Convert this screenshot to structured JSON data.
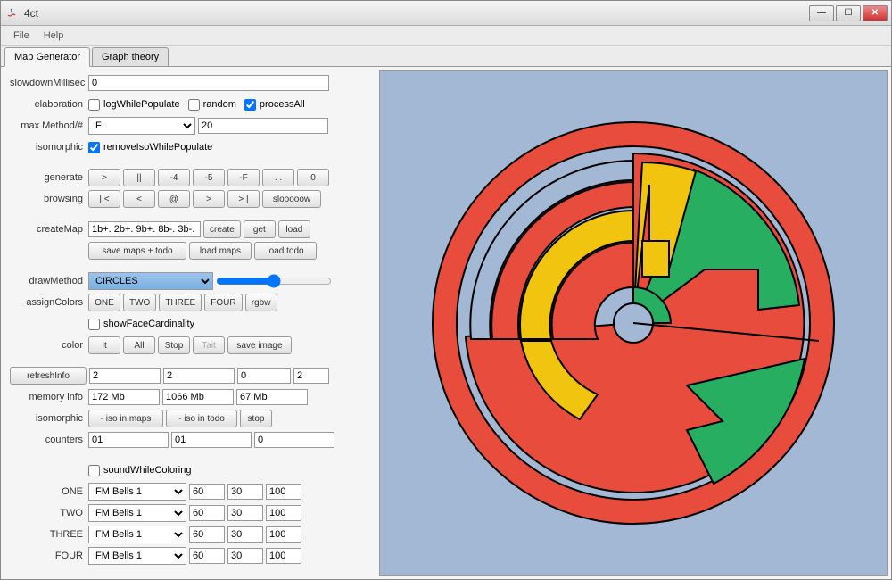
{
  "window": {
    "title": "4ct"
  },
  "menu": {
    "file": "File",
    "help": "Help"
  },
  "tabs": {
    "map_gen": "Map Generator",
    "graph_theory": "Graph theory"
  },
  "labels": {
    "slowdown": "slowdownMillisec",
    "elaboration": "elaboration",
    "maxMethod": "max Method/#",
    "isomorphic": "isomorphic",
    "generate": "generate",
    "browsing": "browsing",
    "createMap": "createMap",
    "drawMethod": "drawMethod",
    "assignColors": "assignColors",
    "color": "color",
    "memoryInfo": "memory info",
    "isomorphic2": "isomorphic",
    "counters": "counters",
    "one": "ONE",
    "two": "TWO",
    "three": "THREE",
    "four": "FOUR"
  },
  "values": {
    "slowdown": "0",
    "maxMethodSel": "F",
    "maxMethodNum": "20",
    "createMapStr": "1b+. 2b+. 9b+. 8b-. 3b-.",
    "drawMethod": "CIRCLES",
    "refresh1": "2",
    "refresh2": "2",
    "refresh3": "0",
    "refresh4": "2",
    "mem1": "172 Mb",
    "mem2": "1066 Mb",
    "mem3": "67 Mb",
    "cnt1": "01",
    "cnt2": "01",
    "cnt3": "0",
    "soundSel": "FM Bells 1",
    "s1": "60",
    "s2": "30",
    "s3": "100"
  },
  "cb": {
    "logWhilePopulate": "logWhilePopulate",
    "random": "random",
    "processAll": "processAll",
    "removeIso": "removeIsoWhilePopulate",
    "showFaceCard": "showFaceCardinality",
    "soundWhile": "soundWhileColoring"
  },
  "btns": {
    "gen_gt": ">",
    "gen_pipe": "||",
    "gen_m4": "-4",
    "gen_m5": "-5",
    "gen_mf": "-F",
    "gen_dot": ". .",
    "gen_0": "0",
    "brow_bar_lt": "| <",
    "brow_lt": "<",
    "brow_at": "@",
    "brow_gt": ">",
    "brow_gt_bar": "> |",
    "brow_slow": "slooooow",
    "create": "create",
    "get": "get",
    "load": "load",
    "saveMaps": "save maps + todo",
    "loadMaps": "load maps",
    "loadTodo": "load todo",
    "one": "ONE",
    "two": "TWO",
    "three": "THREE",
    "four": "FOUR",
    "rgbw": "rgbw",
    "it": "It",
    "all": "All",
    "stop": "Stop",
    "tait": "Tait",
    "saveImage": "save image",
    "refreshInfo": "refreshInfo",
    "isoMaps": "- iso in maps",
    "isoTodo": "- iso in todo",
    "stop2": "stop"
  }
}
